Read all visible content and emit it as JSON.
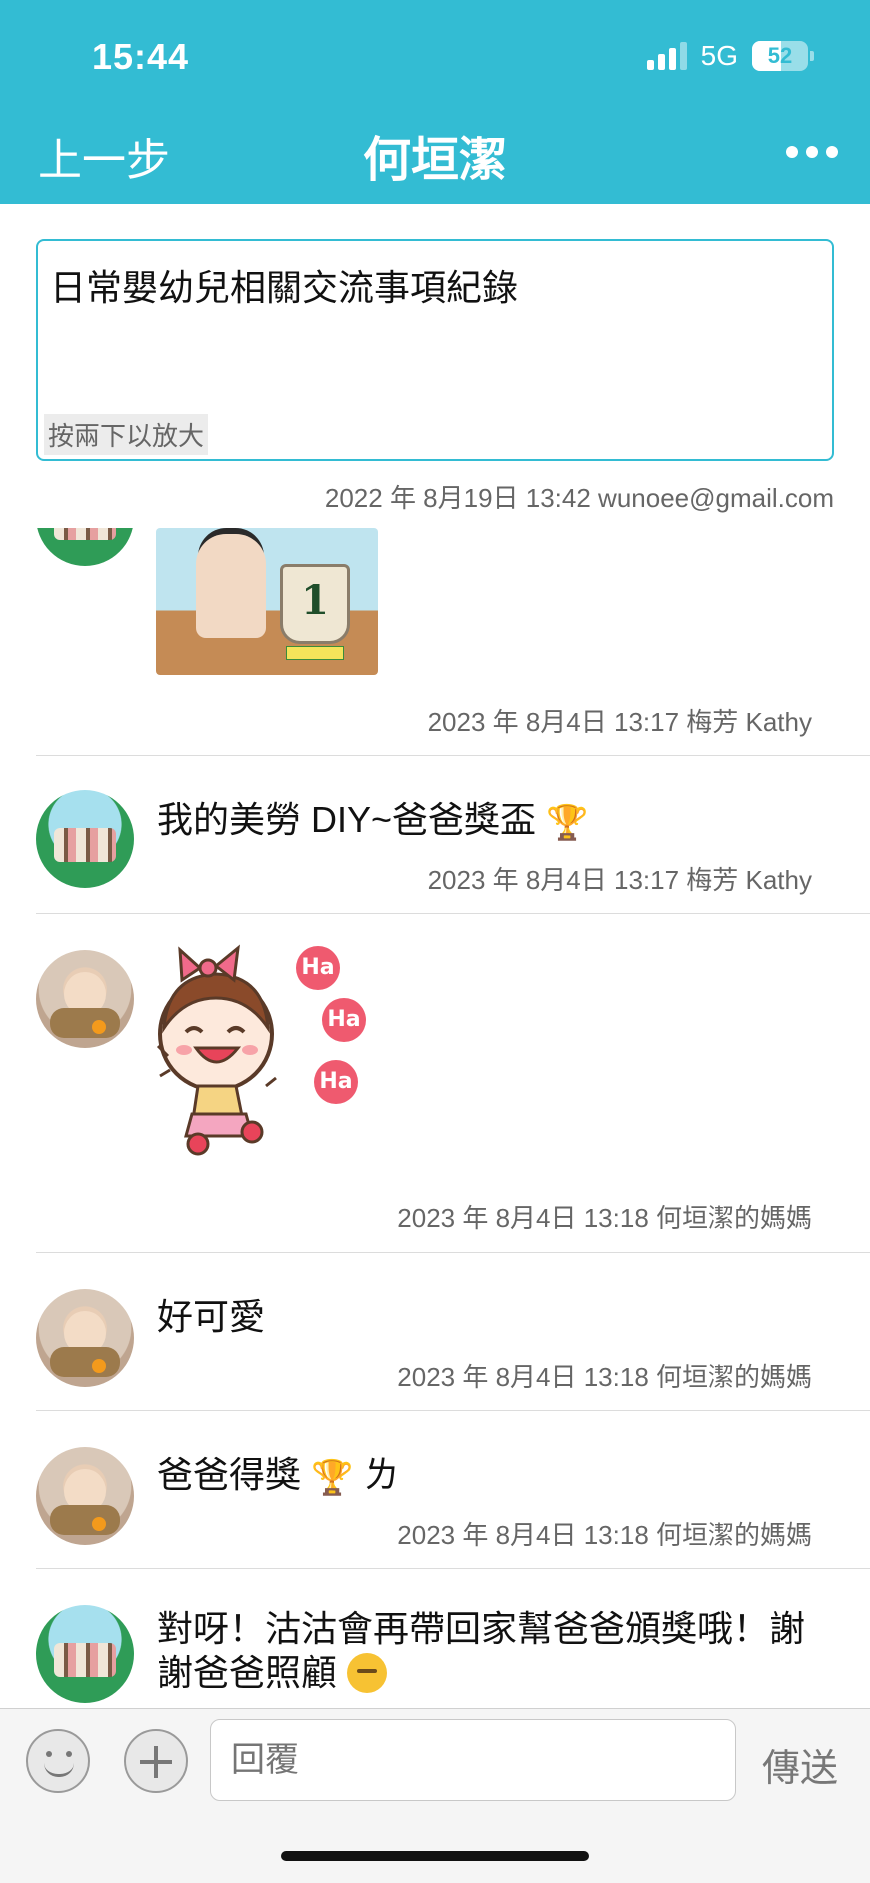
{
  "status_bar": {
    "time": "15:44",
    "network": "5G",
    "battery": "52"
  },
  "nav": {
    "back_label": "上一步",
    "title": "何垣潔"
  },
  "description": {
    "text": "日常嬰幼兒相關交流事項紀錄",
    "hint": "按兩下以放大",
    "meta": "2022 年 8月19日 13:42 wunoee@gmail.com"
  },
  "messages": [
    {
      "meta": "2023 年 8月4日 13:17 梅芳 Kathy"
    },
    {
      "text": "我的美勞 DIY~爸爸獎盃",
      "meta": "2023 年 8月4日 13:17 梅芳 Kathy"
    },
    {
      "sticker_text": [
        "Ha",
        "Ha",
        "Ha"
      ],
      "meta": "2023 年 8月4日 13:18 何垣潔的媽媽"
    },
    {
      "text": "好可愛",
      "meta": "2023 年 8月4日 13:18 何垣潔的媽媽"
    },
    {
      "text_before": "爸爸得獎",
      "text_after": "ㄌ",
      "meta": "2023 年 8月4日 13:18 何垣潔的媽媽"
    },
    {
      "text_line1": "對呀！沽沽會再帶回家幫爸爸頒獎哦！謝",
      "text_line2": "謝爸爸照顧"
    }
  ],
  "photo_text": "1",
  "emoji": {
    "trophy": "🏆"
  },
  "reply": {
    "placeholder": "回覆",
    "send_label": "傳送"
  },
  "colors": {
    "accent": "#33bcd3",
    "meta_text": "#666666",
    "sticker_red": "#ef5a6f"
  },
  "icons": [
    "signal-icon",
    "battery-icon",
    "more-icon",
    "smiley-icon",
    "plus-icon",
    "trophy-icon",
    "kiss-emoji-icon"
  ]
}
